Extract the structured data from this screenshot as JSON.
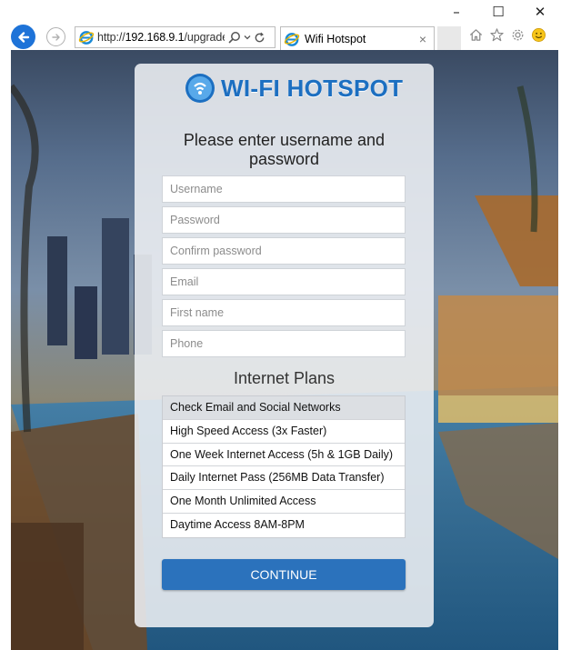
{
  "browser": {
    "address_prefix": "http://",
    "address_host": "192.168.9.1",
    "address_path": "/upgrade",
    "tab_title": "Wifi Hotspot",
    "tab_close": "×",
    "window_minimize": "–",
    "window_maximize": "☐",
    "window_close": "✕"
  },
  "hotspot": {
    "logo_text": "WI-FI HOTSPOT",
    "heading": "Please enter username and password",
    "fields": {
      "username": "Username",
      "password": "Password",
      "confirm_password": "Confirm password",
      "email": "Email",
      "first_name": "First name",
      "phone": "Phone"
    },
    "plans_title": "Internet Plans",
    "plans": [
      "Check Email and Social Networks",
      "High Speed Access (3x Faster)",
      "One Week Internet Access (5h & 1GB Daily)",
      "Daily Internet Pass (256MB Data Transfer)",
      "One Month Unlimited Access",
      "Daytime Access 8AM-8PM"
    ],
    "selected_plan": "Check Email and Social Networks",
    "continue_label": "CONTINUE"
  },
  "colors": {
    "accent": "#2b72bc",
    "logo": "#1c6fc1",
    "back_button": "#1e73d8"
  }
}
